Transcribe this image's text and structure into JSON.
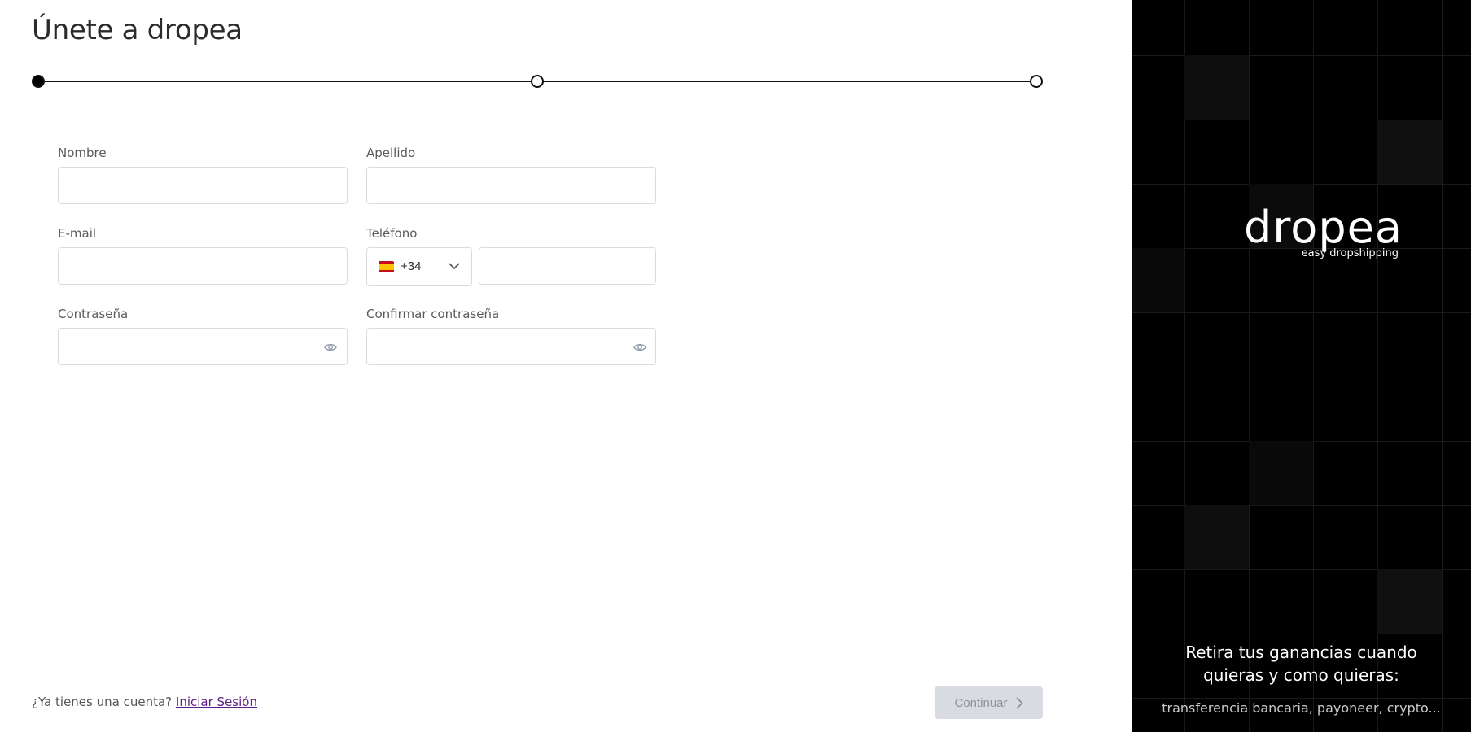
{
  "page": {
    "title": "Únete a dropea"
  },
  "stepper": {
    "total_steps": 3,
    "current_step": 1
  },
  "form": {
    "first_name": {
      "label": "Nombre",
      "value": "",
      "placeholder": ""
    },
    "last_name": {
      "label": "Apellido",
      "value": "",
      "placeholder": ""
    },
    "email": {
      "label": "E-mail",
      "value": "",
      "placeholder": ""
    },
    "phone": {
      "label": "Teléfono",
      "country_flag": "spain-flag-icon",
      "dial_code": "+34",
      "value": "",
      "placeholder": ""
    },
    "password": {
      "label": "Contraseña",
      "value": "",
      "placeholder": ""
    },
    "confirm_password": {
      "label": "Confirmar contraseña",
      "value": "",
      "placeholder": ""
    }
  },
  "footer": {
    "have_account_text": "¿Ya tienes una cuenta?",
    "login_link": "Iniciar Sesión",
    "continue_label": "Continuar"
  },
  "promo": {
    "logo_word": "dropea",
    "logo_tagline": "easy dropshipping",
    "headline_line1": "Retira tus ganancias cuando",
    "headline_line2": "quieras y como quieras:",
    "subtext": "transferencia bancaria, payoneer, crypto..."
  },
  "colors": {
    "accent_dark": "#000000",
    "link": "#5b1e85",
    "button_disabled_bg": "#d8dbe1",
    "button_disabled_text": "#8d929b",
    "input_border": "#d9dbe0"
  }
}
